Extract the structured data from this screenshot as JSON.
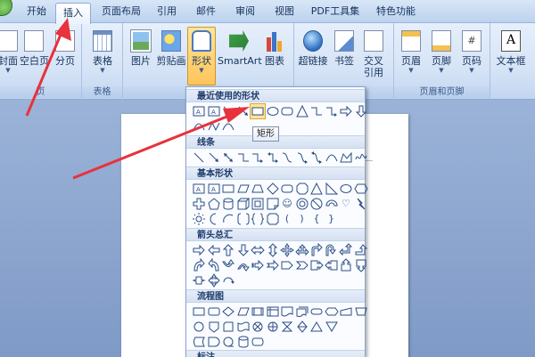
{
  "tabs": [
    {
      "label": "开始"
    },
    {
      "label": "插入"
    },
    {
      "label": "页面布局"
    },
    {
      "label": "引用"
    },
    {
      "label": "邮件"
    },
    {
      "label": "审阅"
    },
    {
      "label": "视图"
    },
    {
      "label": "PDF工具集"
    },
    {
      "label": "特色功能"
    }
  ],
  "ribbon": {
    "pages_group": {
      "label": "页",
      "buttons": [
        "封面",
        "空白页",
        "分页"
      ]
    },
    "tables_group": {
      "label": "表格",
      "buttons": [
        "表格"
      ]
    },
    "illustrations_group": {
      "buttons": [
        "图片",
        "剪贴画",
        "形状",
        "SmartArt",
        "图表"
      ]
    },
    "links_group": {
      "buttons": [
        "超链接",
        "书签",
        "交叉",
        "引用"
      ]
    },
    "header_footer_group": {
      "label": "页眉和页脚",
      "buttons": [
        "页眉",
        "页脚",
        "页码"
      ]
    },
    "text_group": {
      "buttons": [
        "文本框"
      ]
    }
  },
  "shapes_menu": {
    "sections": [
      {
        "title": "最近使用的形状"
      },
      {
        "title": "线条"
      },
      {
        "title": "基本形状"
      },
      {
        "title": "箭头总汇"
      },
      {
        "title": "流程图"
      },
      {
        "title": "标注"
      }
    ],
    "tooltip": "矩形",
    "basic_glyphs": [
      "☺",
      "♡",
      "(",
      ")",
      "{",
      "}",
      "[",
      "]"
    ]
  },
  "icons": {
    "annotation_arrow_color": "#e8323c",
    "highlight_color": "#ffd45a"
  }
}
